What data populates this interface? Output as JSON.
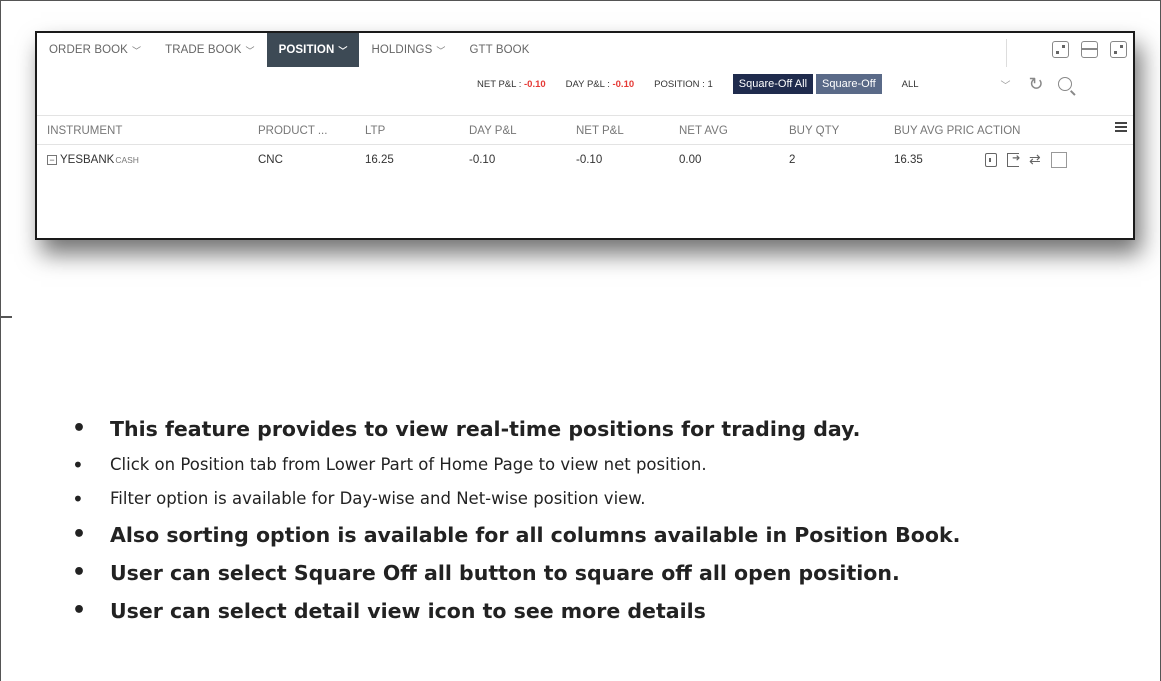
{
  "tabs": [
    {
      "label": "ORDER BOOK",
      "chevron": true
    },
    {
      "label": "TRADE BOOK",
      "chevron": true
    },
    {
      "label": "POSITION",
      "chevron": true,
      "active": true
    },
    {
      "label": "HOLDINGS",
      "chevron": true
    },
    {
      "label": "GTT BOOK",
      "chevron": false
    }
  ],
  "summary": {
    "net_pl_label": "NET P&L : ",
    "net_pl_value": "-0.10",
    "day_pl_label": "DAY P&L : ",
    "day_pl_value": "-0.10",
    "position_label": "POSITION : 1",
    "square_off_all": "Square-Off All",
    "square_off": "Square-Off",
    "filter": "ALL"
  },
  "columns": [
    "INSTRUMENT",
    "PRODUCT ...",
    "LTP",
    "DAY P&L",
    "NET P&L",
    "NET AVG",
    "BUY QTY",
    "BUY AVG PRIC",
    "ACTION"
  ],
  "rows": [
    {
      "symbol": "YESBANK",
      "segment": "CASH",
      "product": "CNC",
      "ltp": "16.25",
      "day_pl": "-0.10",
      "net_pl": "-0.10",
      "net_avg": "0.00",
      "buy_qty": "2",
      "buy_avg": "16.35"
    }
  ],
  "bullets": [
    {
      "text": "This feature provides to view real-time positions for trading day.",
      "style": "big"
    },
    {
      "text": "Click on Position tab from Lower Part of Home Page to view net position.",
      "style": "small"
    },
    {
      "text": "Filter option is available for Day-wise and Net-wise position view.",
      "style": "small"
    },
    {
      "text": "Also sorting option is available for all columns available in Position Book.",
      "style": "big"
    },
    {
      "text": "User can select Square Off all button to square off all open position.",
      "style": "big"
    },
    {
      "text": "User can select detail view icon to see more details",
      "style": "big"
    }
  ],
  "colors": {
    "active_tab": "#3d4a55",
    "negative": "#e53935",
    "btn_dark": "#1f2b4d",
    "btn_grey": "#5a6a88"
  },
  "icons": [
    "popout-icon",
    "split-view-icon",
    "maximize-icon",
    "refresh-icon",
    "search-icon",
    "column-menu-icon",
    "expand-icon",
    "detail-view-icon",
    "exit-position-icon",
    "convert-icon",
    "select-checkbox"
  ]
}
